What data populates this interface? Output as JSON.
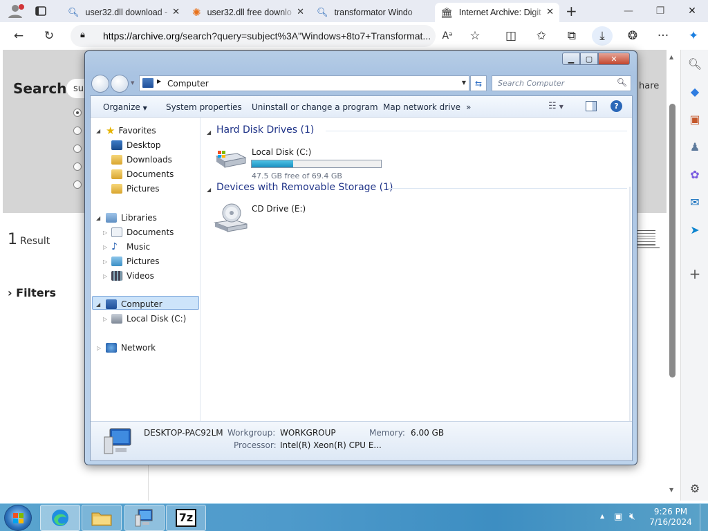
{
  "browser": {
    "tabs": [
      {
        "label": "user32.dll download -",
        "icon": "search-icon"
      },
      {
        "label": "user32.dll free downlo",
        "icon": "dll-site-icon"
      },
      {
        "label": "transformator Windo",
        "icon": "search-icon"
      },
      {
        "label": "Internet Archive: Digit",
        "icon": "archive-icon",
        "active": true
      }
    ],
    "url_host": "https://archive.org",
    "url_path": "/search?query=subject%3A\"Windows+8to7+Transformat...",
    "read_aloud": "Aᵃ"
  },
  "page": {
    "search_label": "Search",
    "search_value": "su",
    "share_text": "hare",
    "result_count": "1",
    "result_label": "Result",
    "filters_label": "Filters"
  },
  "explorer": {
    "address": "Computer",
    "search_placeholder": "Search Computer",
    "commands": {
      "organize": "Organize",
      "system_properties": "System properties",
      "uninstall": "Uninstall or change a program",
      "map_drive": "Map network drive",
      "more": "»"
    },
    "nav": {
      "favorites": "Favorites",
      "desktop": "Desktop",
      "downloads": "Downloads",
      "documents": "Documents",
      "pictures": "Pictures",
      "libraries": "Libraries",
      "lib_documents": "Documents",
      "lib_music": "Music",
      "lib_pictures": "Pictures",
      "lib_videos": "Videos",
      "computer": "Computer",
      "local_disk": "Local Disk (C:)",
      "network": "Network"
    },
    "groups": {
      "hdd": "Hard Disk Drives (1)",
      "removable": "Devices with Removable Storage (1)"
    },
    "drive_c": {
      "name": "Local Disk (C:)",
      "free": "47.5 GB free of 69.4 GB",
      "used_fraction": 0.32
    },
    "drive_e": {
      "name": "CD Drive (E:)"
    },
    "details": {
      "computer_name": "DESKTOP-PAC92LM",
      "workgroup_label": "Workgroup:",
      "workgroup": "WORKGROUP",
      "memory_label": "Memory:",
      "memory": "6.00 GB",
      "processor_label": "Processor:",
      "processor": "Intel(R) Xeon(R) CPU E..."
    }
  },
  "taskbar": {
    "time": "9:26 PM",
    "date": "7/16/2024",
    "seven_zip": "7z"
  }
}
